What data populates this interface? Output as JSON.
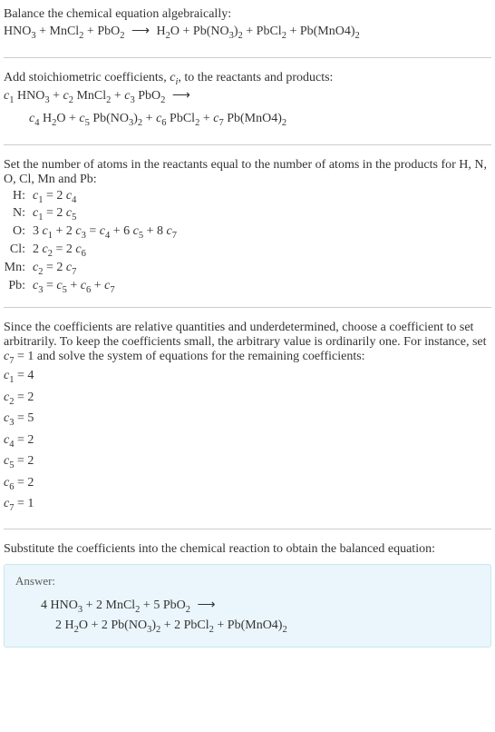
{
  "intro": {
    "title": "Balance the chemical equation algebraically:",
    "equation": "HNO₃ + MnCl₂ + PbO₂ ⟶ H₂O + Pb(NO₃)₂ + PbCl₂ + Pb(MnO4)₂"
  },
  "step1": {
    "text": "Add stoichiometric coefficients, ",
    "ci": "cᵢ",
    "text2": ", to the reactants and products:",
    "line1": "c₁ HNO₃ + c₂ MnCl₂ + c₃ PbO₂ ⟶",
    "line2": "c₄ H₂O + c₅ Pb(NO₃)₂ + c₆ PbCl₂ + c₇ Pb(MnO4)₂"
  },
  "step2": {
    "text": "Set the number of atoms in the reactants equal to the number of atoms in the products for H, N, O, Cl, Mn and Pb:",
    "rows": [
      {
        "label": "H:",
        "eq": "c₁ = 2 c₄"
      },
      {
        "label": "N:",
        "eq": "c₁ = 2 c₅"
      },
      {
        "label": "O:",
        "eq": "3 c₁ + 2 c₃ = c₄ + 6 c₅ + 8 c₇"
      },
      {
        "label": "Cl:",
        "eq": "2 c₂ = 2 c₆"
      },
      {
        "label": "Mn:",
        "eq": "c₂ = 2 c₇"
      },
      {
        "label": "Pb:",
        "eq": "c₃ = c₅ + c₆ + c₇"
      }
    ]
  },
  "step3": {
    "text": "Since the coefficients are relative quantities and underdetermined, choose a coefficient to set arbitrarily. To keep the coefficients small, the arbitrary value is ordinarily one. For instance, set c₇ = 1 and solve the system of equations for the remaining coefficients:",
    "coefs": [
      "c₁ = 4",
      "c₂ = 2",
      "c₃ = 5",
      "c₄ = 2",
      "c₅ = 2",
      "c₆ = 2",
      "c₇ = 1"
    ]
  },
  "step4": {
    "text": "Substitute the coefficients into the chemical reaction to obtain the balanced equation:"
  },
  "answer": {
    "label": "Answer:",
    "line1": "4 HNO₃ + 2 MnCl₂ + 5 PbO₂ ⟶",
    "line2": "2 H₂O + 2 Pb(NO₃)₂ + 2 PbCl₂ + Pb(MnO4)₂"
  }
}
